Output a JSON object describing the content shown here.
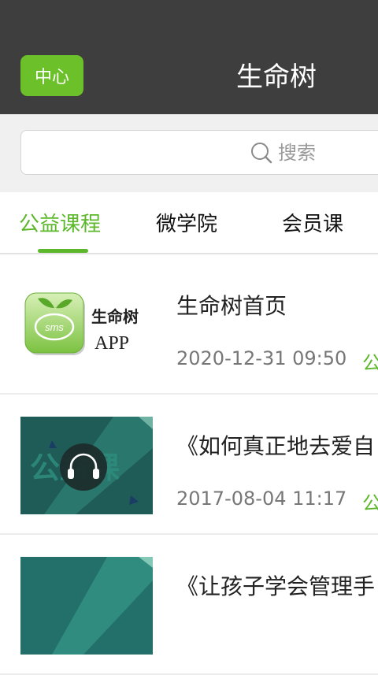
{
  "header": {
    "center_button": "中心",
    "title": "生命树"
  },
  "search": {
    "placeholder": "搜索"
  },
  "tabs": [
    {
      "label": "公益课程",
      "active": true
    },
    {
      "label": "微学院",
      "active": false
    },
    {
      "label": "会员课",
      "active": false
    }
  ],
  "items": [
    {
      "title": "生命树首页",
      "date": "2020-12-31 09:50",
      "tag": "公",
      "thumb": {
        "type": "app-logo",
        "logo_text": "sms",
        "name": "生命树",
        "sub": "APP"
      }
    },
    {
      "title": "《如何真正地去爱自",
      "date": "2017-08-04 11:17",
      "tag": "公",
      "thumb": {
        "type": "course-banner",
        "watermark": "公益课",
        "icon": "headphones-icon"
      }
    },
    {
      "title": "《让孩子学会管理手",
      "date": "",
      "tag": "",
      "thumb": {
        "type": "course-banner",
        "icon": "headphones-icon"
      }
    }
  ],
  "colors": {
    "header_bg": "#3e3e3e",
    "accent": "#5cb82a",
    "banner_bg": "#1f5c58"
  }
}
